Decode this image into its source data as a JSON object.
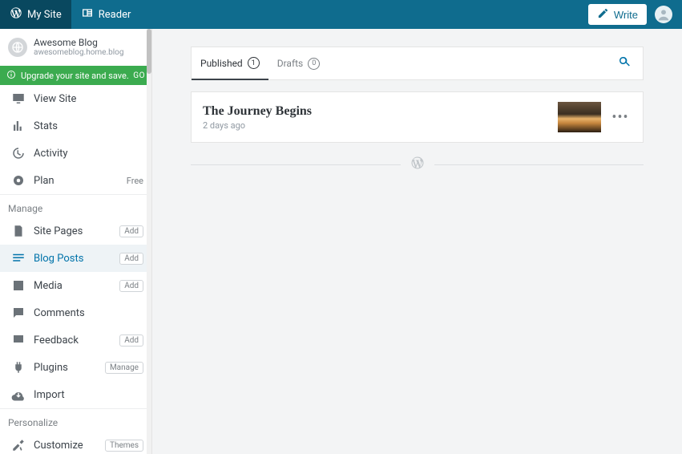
{
  "topbar": {
    "mysite": "My Site",
    "reader": "Reader",
    "write": "Write"
  },
  "site": {
    "name": "Awesome Blog",
    "url": "awesomeblog.home.blog"
  },
  "upgrade": {
    "text": "Upgrade your site and save.",
    "go": "GO"
  },
  "nav": {
    "view_site": "View Site",
    "stats": "Stats",
    "activity": "Activity",
    "plan": "Plan",
    "plan_badge": "Free"
  },
  "section_manage": "Manage",
  "manage": {
    "pages": "Site Pages",
    "posts": "Blog Posts",
    "media": "Media",
    "comments": "Comments",
    "feedback": "Feedback",
    "plugins": "Plugins",
    "import": "Import",
    "add": "Add",
    "manage_btn": "Manage"
  },
  "section_personalize": "Personalize",
  "personalize": {
    "customize": "Customize",
    "themes": "Themes"
  },
  "tabs": {
    "published": "Published",
    "published_count": "1",
    "drafts": "Drafts",
    "drafts_count": "0"
  },
  "post": {
    "title": "The Journey Begins",
    "time": "2 days ago"
  }
}
